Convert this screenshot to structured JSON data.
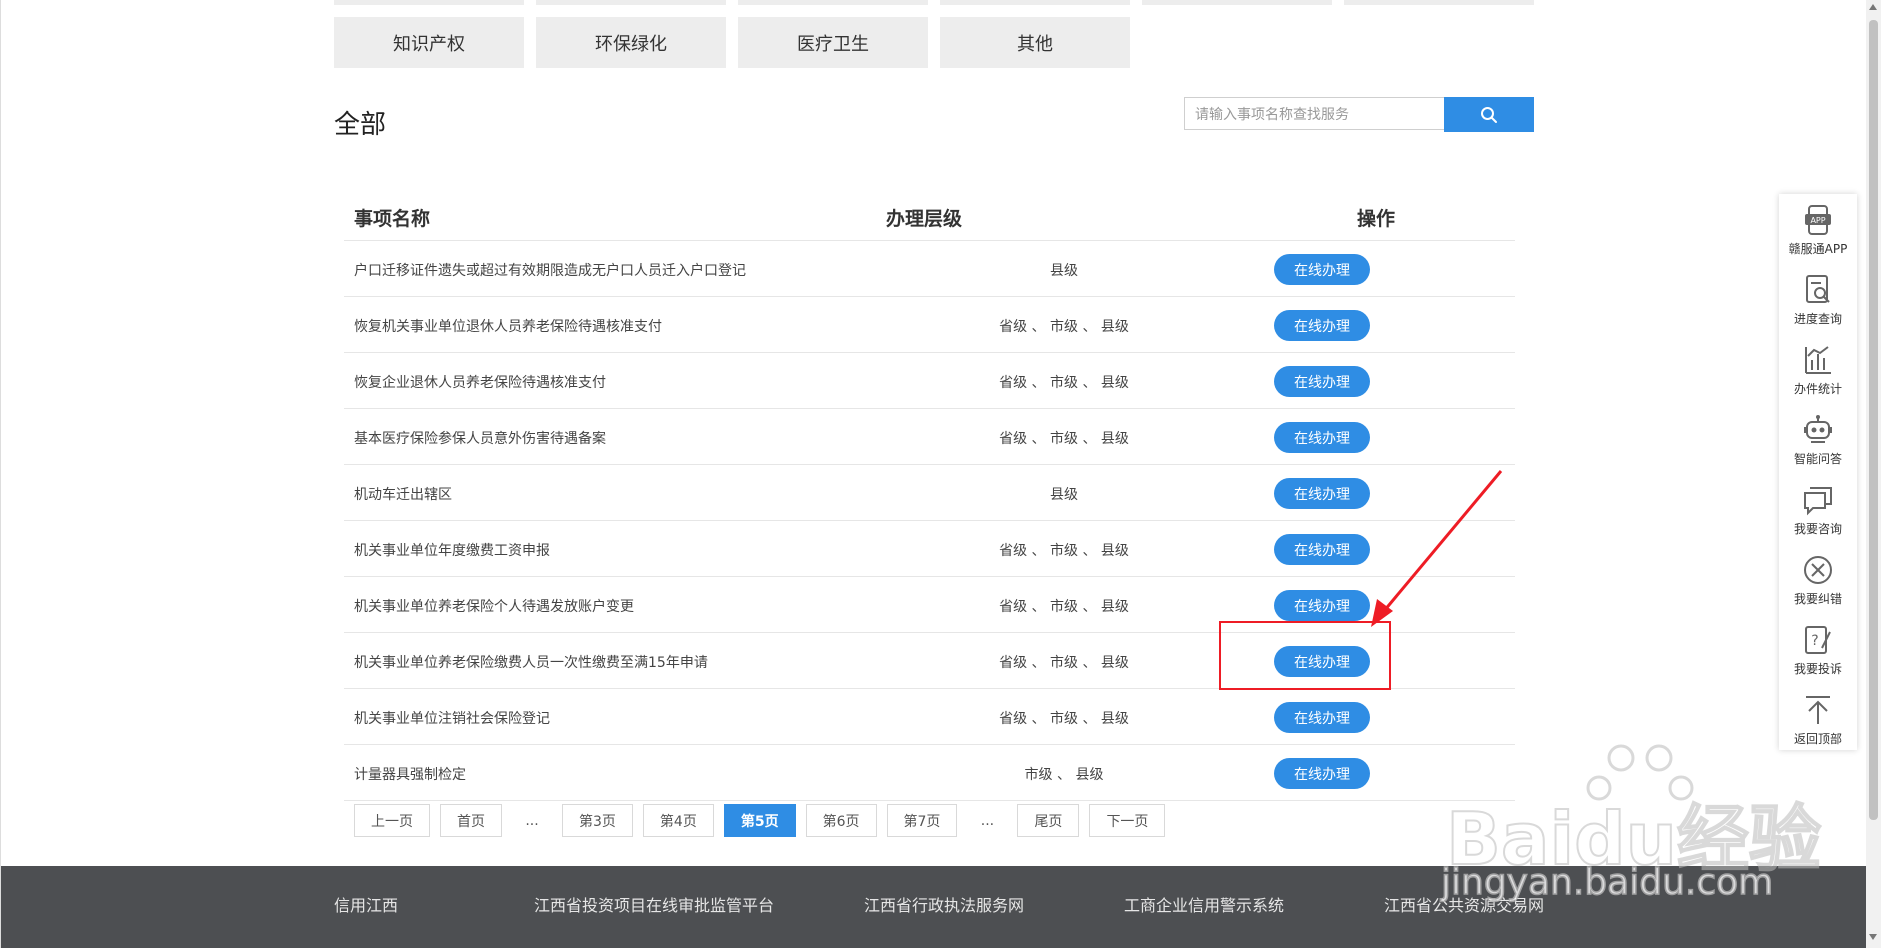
{
  "categories": [
    "知识产权",
    "环保绿化",
    "医疗卫生",
    "其他"
  ],
  "section_title": "全部",
  "search": {
    "placeholder": "请输入事项名称查找服务",
    "icon": "search-icon"
  },
  "table": {
    "headers": {
      "name": "事项名称",
      "level": "办理层级",
      "op": "操作"
    },
    "rows": [
      {
        "name": "户口迁移证件遗失或超过有效期限造成无户口人员迁入户口登记",
        "level": "县级",
        "op": "在线办理"
      },
      {
        "name": "恢复机关事业单位退休人员养老保险待遇核准支付",
        "level": "省级 、 市级 、 县级",
        "op": "在线办理"
      },
      {
        "name": "恢复企业退休人员养老保险待遇核准支付",
        "level": "省级 、 市级 、 县级",
        "op": "在线办理"
      },
      {
        "name": "基本医疗保险参保人员意外伤害待遇备案",
        "level": "省级 、 市级 、 县级",
        "op": "在线办理"
      },
      {
        "name": "机动车迁出辖区",
        "level": "县级",
        "op": "在线办理"
      },
      {
        "name": "机关事业单位年度缴费工资申报",
        "level": "省级 、 市级 、 县级",
        "op": "在线办理"
      },
      {
        "name": "机关事业单位养老保险个人待遇发放账户变更",
        "level": "省级 、 市级 、 县级",
        "op": "在线办理"
      },
      {
        "name": "机关事业单位养老保险缴费人员一次性缴费至满15年申请",
        "level": "省级 、 市级 、 县级",
        "op": "在线办理"
      },
      {
        "name": "机关事业单位注销社会保险登记",
        "level": "省级 、 市级 、 县级",
        "op": "在线办理"
      },
      {
        "name": "计量器具强制检定",
        "level": "市级 、 县级",
        "op": "在线办理"
      }
    ]
  },
  "pager": {
    "prev": "上一页",
    "first": "首页",
    "ellipsis": "...",
    "pages": [
      "第3页",
      "第4页",
      "第5页",
      "第6页",
      "第7页"
    ],
    "active": "第5页",
    "last": "尾页",
    "next": "下一页"
  },
  "footer": [
    "信用江西",
    "江西省投资项目在线审批监管平台",
    "江西省行政执法服务网",
    "工商企业信用警示系统",
    "江西省公共资源交易网"
  ],
  "sidebar": [
    {
      "label": "赣服通APP",
      "icon": "app-icon"
    },
    {
      "label": "进度查询",
      "icon": "progress-query-icon"
    },
    {
      "label": "办件统计",
      "icon": "statistics-icon"
    },
    {
      "label": "智能问答",
      "icon": "robot-icon"
    },
    {
      "label": "我要咨询",
      "icon": "chat-icon"
    },
    {
      "label": "我要纠错",
      "icon": "error-correct-icon"
    },
    {
      "label": "我要投诉",
      "icon": "complaint-icon"
    },
    {
      "label": "返回顶部",
      "icon": "back-to-top-icon"
    }
  ],
  "watermark": {
    "brand": "Baidu经验",
    "url": "jingyan.baidu.com"
  },
  "colors": {
    "primary": "#2f8de4",
    "footer": "#4d4f52",
    "highlight": "#ee1c25"
  }
}
